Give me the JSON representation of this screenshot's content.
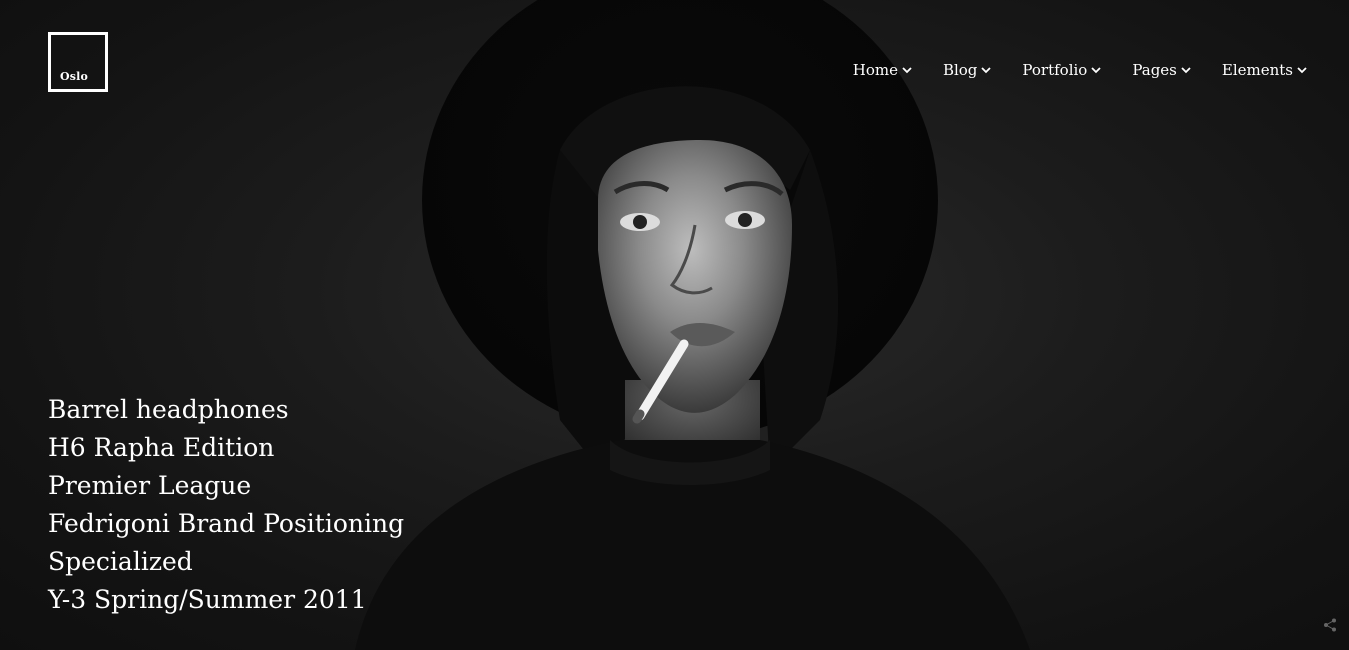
{
  "logo": {
    "text": "Oslo"
  },
  "nav": {
    "items": [
      {
        "label": "Home",
        "icon": "chevron-down-icon"
      },
      {
        "label": "Blog",
        "icon": "chevron-down-icon"
      },
      {
        "label": "Portfolio",
        "icon": "chevron-down-icon"
      },
      {
        "label": "Pages",
        "icon": "chevron-down-icon"
      },
      {
        "label": "Elements",
        "icon": "chevron-down-icon"
      }
    ]
  },
  "projects": [
    "Barrel headphones",
    "H6 Rapha Edition",
    "Premier League",
    "Fedrigoni Brand Positioning",
    "Specialized",
    "Y-3 Spring/Summer 2011"
  ],
  "hero": {
    "image": "black-and-white portrait photo",
    "palette": {
      "background": "#151515",
      "text": "#ffffff"
    }
  },
  "corner_icon": "share-icon"
}
